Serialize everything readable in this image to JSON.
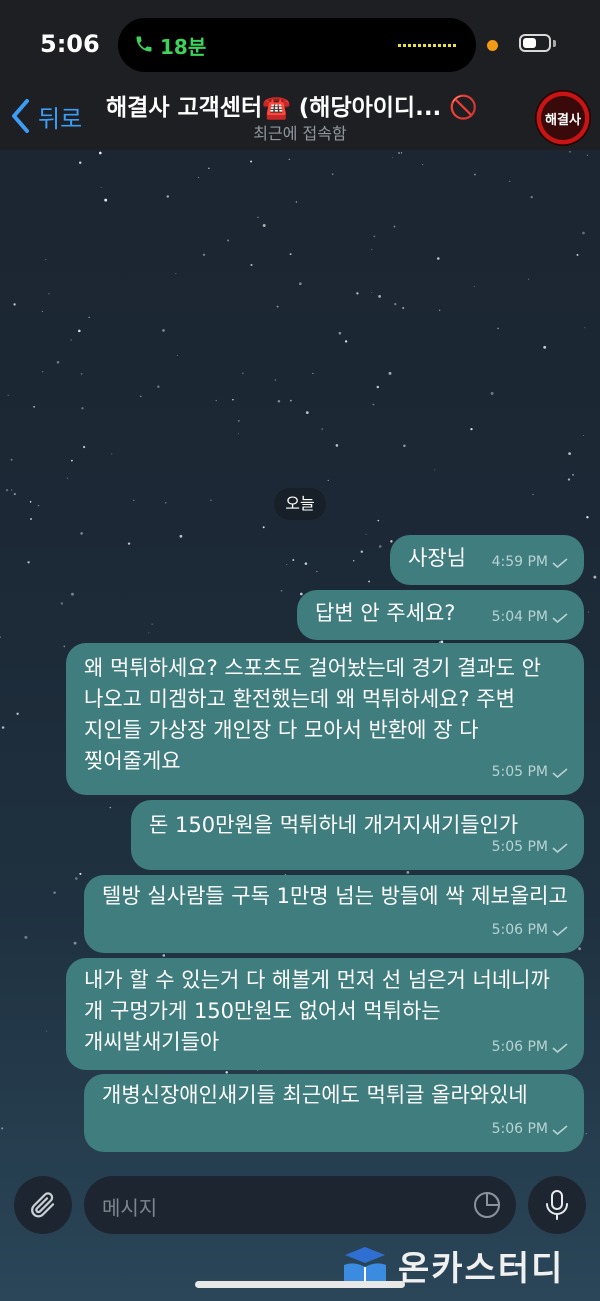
{
  "status_bar": {
    "time": "5:06",
    "call_duration": "18분"
  },
  "header": {
    "back_label": "뒤로",
    "title": "해결사 고객센터☎️ (해당아이디... 🚫",
    "subtitle": "최근에 접속함",
    "avatar_text": "해결사"
  },
  "date_separator": "오늘",
  "messages": [
    {
      "text": "사장님",
      "time": "4:59 PM"
    },
    {
      "text": "답변 안 주세요?",
      "time": "5:04 PM"
    },
    {
      "text": "왜 먹튀하세요? 스포츠도 걸어놨는데 경기 결과도 안 나오고 미겜하고 환전했는데 왜 먹튀하세요? 주변 지인들 가상장 개인장 다 모아서 반환에 장 다 찢어줄게요",
      "time": "5:05 PM"
    },
    {
      "text": "돈 150만원을 먹튀하네 개거지새기들인가",
      "time": "5:05 PM"
    },
    {
      "text": "텔방 실사람들 구독 1만명 넘는 방들에 싹 제보올리고",
      "time": "5:06 PM"
    },
    {
      "text": "내가 할 수 있는거 다 해볼게 먼저 선 넘은거 너네니까 개 구멍가게 150만원도 없어서 먹튀하는 개씨발새기들아",
      "time": "5:06 PM"
    },
    {
      "text": "개병신장애인새기들 최근에도 먹튀글 올라와있네",
      "time": "5:06 PM"
    }
  ],
  "input": {
    "placeholder": "메시지"
  },
  "watermark": "온카스터디",
  "colors": {
    "outgoing_bubble": "#3f7d7e",
    "link_blue": "#3d9cf5",
    "call_green": "#3ed15c"
  }
}
